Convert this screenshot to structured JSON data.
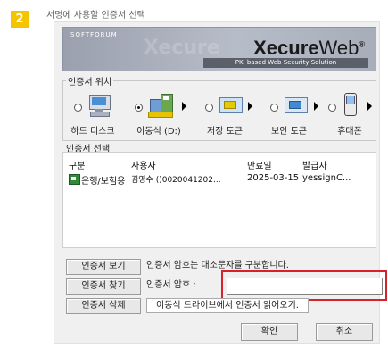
{
  "step": {
    "number": "2",
    "title": "서명에 사용할 인증서 선택"
  },
  "banner": {
    "vendor": "SOFTFORUM",
    "brand_bold": "Xecure",
    "brand_light": "Web",
    "tm": "®",
    "tagline": "PKI based Web Security Solution",
    "watermark": "Xecure"
  },
  "location": {
    "legend": "인증서 위치",
    "devices": [
      {
        "label": "하드 디스크",
        "icon": "hard-disk-icon",
        "selected": false
      },
      {
        "label": "이동식 (D:)",
        "icon": "removable-drive-icon",
        "selected": true
      },
      {
        "label": "저장 토큰",
        "icon": "storage-token-icon",
        "selected": false
      },
      {
        "label": "보안 토큰",
        "icon": "security-token-icon",
        "selected": false
      },
      {
        "label": "휴대폰",
        "icon": "mobile-phone-icon",
        "selected": false
      }
    ]
  },
  "certs": {
    "legend": "인증서 선택",
    "columns": [
      "구분",
      "사용자",
      "만료일",
      "발급자"
    ],
    "rows": [
      {
        "type": "은행/보험용",
        "user": "김영수 ()0020041202...",
        "expiry": "2025-03-15",
        "issuer": "yessignC..."
      }
    ]
  },
  "actions": {
    "view_label": "인증서 보기",
    "find_label": "인증서 찾기",
    "delete_label": "인증서 삭제",
    "case_note": "인증서 암호는 대소문자를 구분합니다.",
    "password_label": "인증서 암호 :",
    "password_value": "",
    "status_text": "이동식 드라이브에서 인증서 읽어오기."
  },
  "footer": {
    "ok_label": "확인",
    "cancel_label": "취소"
  },
  "colors": {
    "step_badge": "#f5c400",
    "highlight": "#d8222b",
    "cert_icon": "#2e8b3a"
  }
}
